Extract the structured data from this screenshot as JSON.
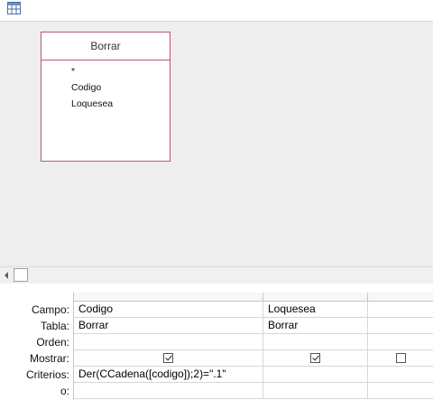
{
  "design": {
    "table": {
      "title": "Borrar",
      "fields": [
        "*",
        "Codigo",
        "Loquesea"
      ]
    }
  },
  "grid": {
    "row_labels": {
      "campo": "Campo:",
      "tabla": "Tabla:",
      "orden": "Orden:",
      "mostrar": "Mostrar:",
      "criterios": "Criterios:",
      "o": "o:"
    },
    "columns": [
      {
        "campo": "Codigo",
        "tabla": "Borrar",
        "orden": "",
        "mostrar": true,
        "criterios": "Der(CCadena([codigo]);2)=\".1\"",
        "o": ""
      },
      {
        "campo": "Loquesea",
        "tabla": "Borrar",
        "orden": "",
        "mostrar": true,
        "criterios": "",
        "o": ""
      },
      {
        "campo": "",
        "tabla": "",
        "orden": "",
        "mostrar": false,
        "criterios": "",
        "o": ""
      }
    ]
  },
  "colors": {
    "table_border": "#b55a6a",
    "design_background": "#eeeeee"
  }
}
